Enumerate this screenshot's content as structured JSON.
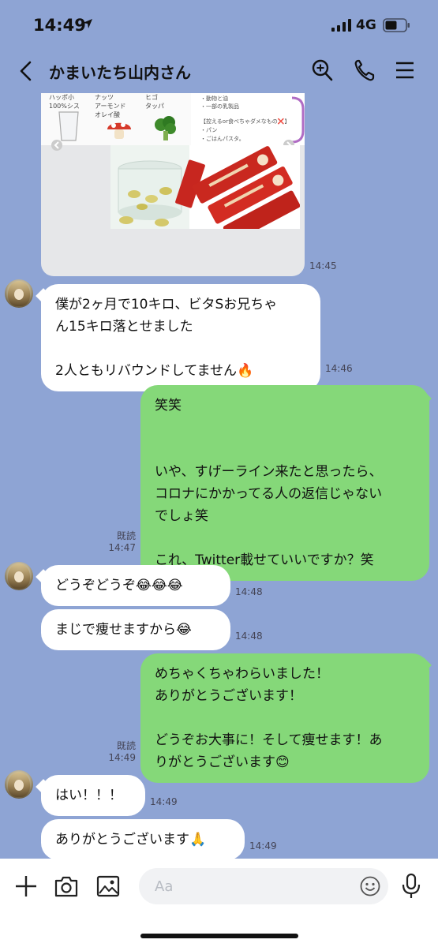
{
  "status": {
    "time": "14:49",
    "network": "4G"
  },
  "header": {
    "title": "かまいたち山内さん",
    "icons": [
      "back-icon",
      "search-icon",
      "phone-icon",
      "menu-icon"
    ]
  },
  "image_message": {
    "time": "14:45",
    "captions": [
      "ハッポ小\n100%シス",
      "ナッツ\nアーモンド\nオレイ酸",
      "ヒゴ\nタッパ"
    ],
    "text_lines": [
      "・動物と油",
      "・一部の乳製品",
      "【控えるor食べちゃダメなもの❌】",
      "・パン",
      "・ごはんパスタ。"
    ]
  },
  "messages": [
    {
      "id": "m1",
      "side": "in",
      "text": "僕が2ヶ月で10キロ、ビタSお兄ちゃ\nん15キロ落とせました\n\n2人ともリバウンドしてません🔥",
      "time": "14:46"
    },
    {
      "id": "m2",
      "side": "out",
      "text": "笑笑\n\n\nいや、すげーライン来たと思ったら、\nコロナにかかってる人の返信じゃない\nでしょ笑\n\nこれ、Twitter載せていいですか？笑",
      "read": "既読",
      "time": "14:47"
    },
    {
      "id": "m3",
      "side": "in",
      "text": "どうぞどうぞ😂😂😂",
      "time": "14:48"
    },
    {
      "id": "m4",
      "side": "in",
      "text": "まじで痩せますから😂",
      "time": "14:48"
    },
    {
      "id": "m5",
      "side": "out",
      "text": "めちゃくちゃわらいました！\nありがとうございます！\n\nどうぞお大事に！そして痩せます！あ\nりがとうございます😊",
      "read": "既読",
      "time": "14:49"
    },
    {
      "id": "m6",
      "side": "in",
      "text": "はい！！！",
      "time": "14:49"
    },
    {
      "id": "m7",
      "side": "in",
      "text": "ありがとうございます🙏",
      "time": "14:49"
    }
  ],
  "input": {
    "placeholder": "Aa",
    "icons": [
      "plus-icon",
      "camera-icon",
      "image-icon",
      "emoji-icon",
      "mic-icon"
    ]
  },
  "colors": {
    "background": "#8ea4d4",
    "outgoing": "#85d879",
    "incoming": "#ffffff"
  }
}
